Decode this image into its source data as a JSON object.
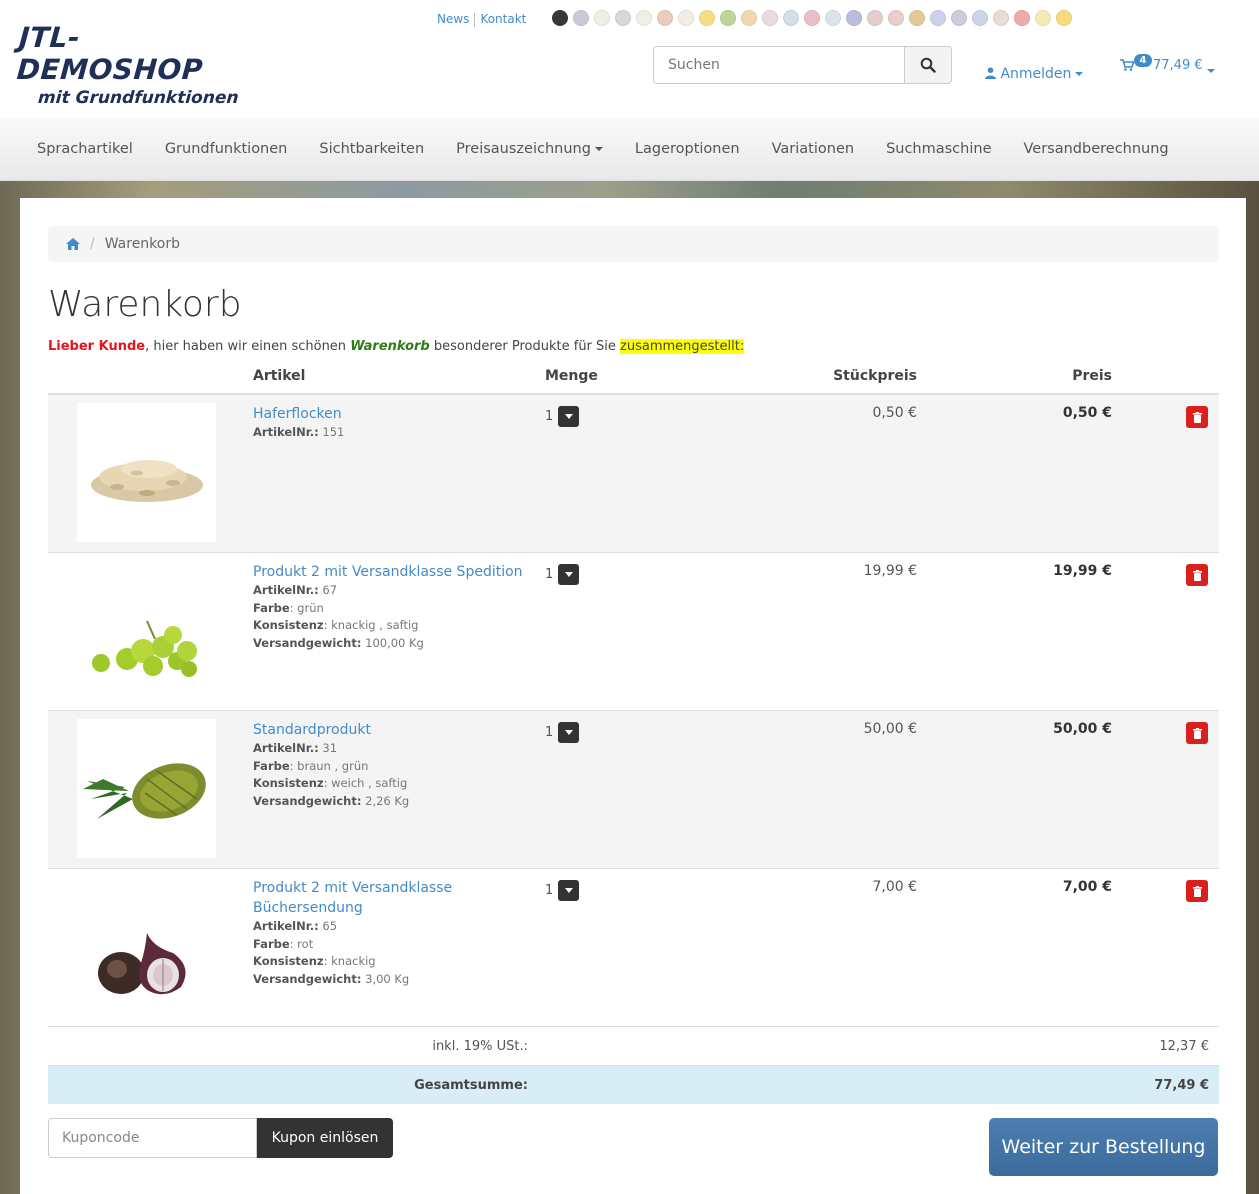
{
  "logo": {
    "line1": "JTL-DEMOSHOP",
    "line2": "mit Grundfunktionen"
  },
  "top_links": {
    "news": "News",
    "kontakt": "Kontakt"
  },
  "flags": [
    "#222222",
    "#c7c3d4",
    "#f0ede2",
    "#d4d4d4",
    "#f0ede2",
    "#e8c9b5",
    "#f0ede2",
    "#f3dc7a",
    "#b6d28a",
    "#efd4a8",
    "#e8d6de",
    "#d0dce8",
    "#e8b8c0",
    "#d7e0ea",
    "#b4b8d8",
    "#e0c8c8",
    "#e8c8c8",
    "#e3c38c",
    "#c8cce8",
    "#c9c6da",
    "#c7d0e4",
    "#e8d8d0",
    "#f0a0a0",
    "#f5e8b0",
    "#f5d870"
  ],
  "search": {
    "placeholder": "Suchen"
  },
  "account": {
    "login_label": "Anmelden"
  },
  "mini_cart": {
    "count": "4",
    "total": "77,49 €"
  },
  "nav": {
    "items": [
      "Sprachartikel",
      "Grundfunktionen",
      "Sichtbarkeiten",
      "Preisauszeichnung",
      "Lageroptionen",
      "Variationen",
      "Suchmaschine",
      "Versandberechnung"
    ]
  },
  "breadcrumb": {
    "current": "Warenkorb"
  },
  "page": {
    "title": "Warenkorb",
    "intro": {
      "part1": "Lieber Kunde",
      "part2": ", hier haben wir einen schönen ",
      "part3": "Warenkorb",
      "part4": " besonderer Produkte für Sie ",
      "part5": "zusammengestellt:"
    }
  },
  "table": {
    "headers": {
      "artikel": "Artikel",
      "menge": "Menge",
      "stueckpreis": "Stückpreis",
      "preis": "Preis"
    },
    "rows": [
      {
        "name": "Haferflocken",
        "artnr_label": "ArtikelNr.:",
        "artnr": "151",
        "qty": "1",
        "unit_price": "0,50 €",
        "price": "0,50 €"
      },
      {
        "name": "Produkt 2 mit Versandklasse Spedition",
        "artnr_label": "ArtikelNr.:",
        "artnr": "67",
        "farbe_label": "Farbe",
        "farbe": ": grün",
        "konsistenz_label": "Konsistenz",
        "konsistenz": ": knackig , saftig",
        "gewicht_label": "Versandgewicht:",
        "gewicht": "100,00 Kg",
        "qty": "1",
        "unit_price": "19,99 €",
        "price": "19,99 €"
      },
      {
        "name": "Standardprodukt",
        "artnr_label": "ArtikelNr.:",
        "artnr": "31",
        "farbe_label": "Farbe",
        "farbe": ": braun , grün",
        "konsistenz_label": "Konsistenz",
        "konsistenz": ": weich , saftig",
        "gewicht_label": "Versandgewicht:",
        "gewicht": "2,26 Kg",
        "qty": "1",
        "unit_price": "50,00 €",
        "price": "50,00 €"
      },
      {
        "name": "Produkt 2 mit Versandklasse Büchersendung",
        "artnr_label": "ArtikelNr.:",
        "artnr": "65",
        "farbe_label": "Farbe",
        "farbe": ": rot",
        "konsistenz_label": "Konsistenz",
        "konsistenz": ": knackig",
        "gewicht_label": "Versandgewicht:",
        "gewicht": "3,00 Kg",
        "qty": "1",
        "unit_price": "7,00 €",
        "price": "7,00 €"
      }
    ],
    "tax_label": "inkl. 19% USt.:",
    "tax_value": "12,37 €",
    "total_label": "Gesamtsumme:",
    "total_value": "77,49 €"
  },
  "coupon": {
    "placeholder": "Kuponcode",
    "button": "Kupon einlösen"
  },
  "checkout_button": "Weiter zur Bestellung",
  "colors": {
    "link": "#428bca",
    "delete": "#d9201d",
    "total_row": "#d9edf7",
    "checkout": "#3b6a9c",
    "highlight": "#ffff00"
  }
}
